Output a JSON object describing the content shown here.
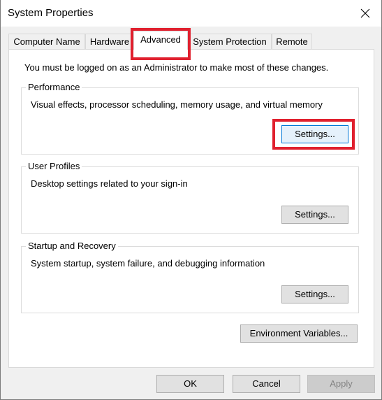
{
  "window": {
    "title": "System Properties",
    "close_icon": "close-icon"
  },
  "tabs": [
    {
      "label": "Computer Name",
      "active": false
    },
    {
      "label": "Hardware",
      "active": false
    },
    {
      "label": "Advanced",
      "active": true
    },
    {
      "label": "System Protection",
      "active": false
    },
    {
      "label": "Remote",
      "active": false
    }
  ],
  "panel": {
    "notice": "You must be logged on as an Administrator to make most of these changes.",
    "groups": [
      {
        "label": "Performance",
        "description": "Visual effects, processor scheduling, memory usage, and virtual memory",
        "button": "Settings..."
      },
      {
        "label": "User Profiles",
        "description": "Desktop settings related to your sign-in",
        "button": "Settings..."
      },
      {
        "label": "Startup and Recovery",
        "description": "System startup, system failure, and debugging information",
        "button": "Settings..."
      }
    ],
    "env_button": "Environment Variables..."
  },
  "footer": {
    "ok": "OK",
    "cancel": "Cancel",
    "apply": "Apply"
  },
  "annotations": {
    "highlight_color": "#e0202e",
    "highlighted": [
      "Advanced tab",
      "Performance Settings... button"
    ]
  }
}
